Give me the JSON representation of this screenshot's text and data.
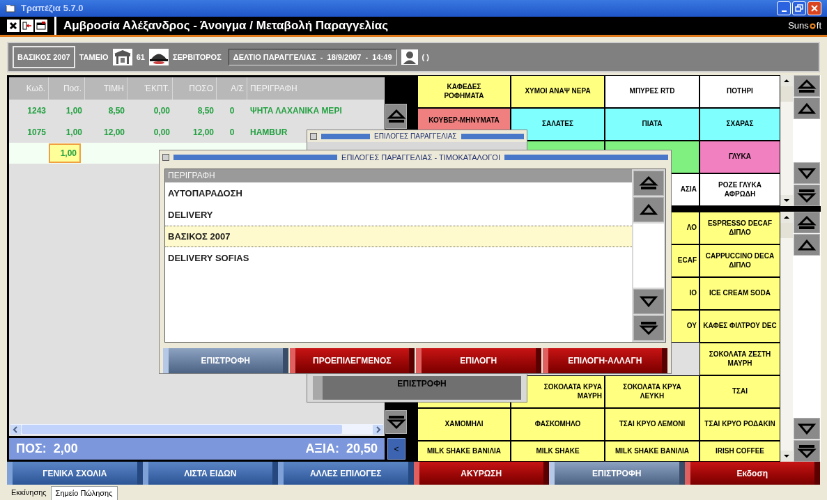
{
  "window": {
    "title": "Τραπέζια 5.7.0"
  },
  "header": {
    "title": "Αμβροσία Αλέξανδρος - Άνοιγμα / Μεταβολή Παραγγελίας",
    "logo_start": "Suns",
    "logo_end": "ft"
  },
  "info_bar": {
    "price_list": "ΒΑΣΙΚΟΣ 2007",
    "register_label": "ΤΑΜΕΙΟ",
    "table_number": "61",
    "waiter_label": "ΣΕΡΒΙΤΟΡΟΣ",
    "document": "ΔΕΛΤΙΟ ΠΑΡΑΓΓΕΛΙΑΣ  -  18/9/2007  -  14:49",
    "customer": "( )"
  },
  "order_table": {
    "columns": [
      "Κωδ.",
      "Ποσ.",
      "ΤΙΜΗ",
      "ΈΚΠΤ.",
      "ΠΟΣΟ",
      "Α/Σ",
      "ΠΕΡΙΓΡΑΦΗ"
    ],
    "rows": [
      {
        "cells": [
          "1243",
          "1,00",
          "8,50",
          "0,00",
          "8,50",
          "0",
          "ΨΗΤΑ ΛΑΧΑΝΙΚΑ ΜΕΡΙ"
        ]
      },
      {
        "cells": [
          "1075",
          "1,00",
          "12,00",
          "0,00",
          "12,00",
          "0",
          "HAMBUR"
        ]
      }
    ],
    "new_row": {
      "quantity": "1,00"
    }
  },
  "totals": {
    "count": "ΠΟΣ:  2,00",
    "value": "ΑΞΙΑ:  20,50",
    "nav_button": "<"
  },
  "category_grid": {
    "cells": [
      {
        "kind": "full",
        "label": "ΚΑΦΕΔΕΣ\nΡΟΦΗΜΑΤΑ",
        "color": "#ffff80"
      },
      {
        "kind": "full",
        "label": "ΧΥΜΟΙ ΑΝΑΨ ΝΕΡΑ",
        "color": "#ffff80"
      },
      {
        "kind": "full",
        "label": "ΜΠΥΡΕΣ RTD",
        "color": "#ffffff"
      },
      {
        "kind": "full",
        "label": "ΠΟΤΗΡΙ",
        "color": "#ffffff"
      },
      {
        "kind": "top",
        "label": "ΚΟΥΒΕΡ-ΜΗΝΥΜΑΤΑ",
        "color": "#f08080"
      },
      {
        "kind": "full",
        "label": "ΣΑΛΑΤΕΣ",
        "color": "#80ffff"
      },
      {
        "kind": "full",
        "label": "ΠΙΑΤΑ",
        "color": "#80ffff"
      },
      {
        "kind": "full",
        "label": "ΣΧΑΡΑΣ",
        "color": "#80ffff"
      },
      {
        "kind": "covered"
      },
      {
        "kind": "empty",
        "color": "#80f080"
      },
      {
        "kind": "empty",
        "color": "#80f080"
      },
      {
        "kind": "full",
        "label": "ΓΛΥΚΑ",
        "color": "#f080c0"
      },
      {
        "kind": "covered"
      },
      {
        "kind": "covered"
      },
      {
        "kind": "right",
        "label": "ΑΣΙΑ",
        "color": "#ffffff"
      },
      {
        "kind": "full",
        "label": "ΡΟΖΕ ΓΛΥΚΑ\nΑΦΡΩΔΗ",
        "color": "#ffffff"
      }
    ]
  },
  "product_grid": {
    "cells": [
      {
        "kind": "covered"
      },
      {
        "kind": "covered"
      },
      {
        "kind": "right",
        "label": "ΛΟ",
        "color": "#ffff80"
      },
      {
        "kind": "full",
        "label": "ESPRESSO DECAF\nΔΙΠΛΟ",
        "color": "#ffff80"
      },
      {
        "kind": "covered"
      },
      {
        "kind": "covered"
      },
      {
        "kind": "right",
        "label": "ECAF",
        "color": "#ffff80"
      },
      {
        "kind": "full",
        "label": "CAPPUCCINO DECA\nΔΙΠΛΟ",
        "color": "#ffff80"
      },
      {
        "kind": "covered"
      },
      {
        "kind": "covered"
      },
      {
        "kind": "right",
        "label": "ΙΟ",
        "color": "#ffff80"
      },
      {
        "kind": "full",
        "label": "ICE CREAM SODA",
        "color": "#ffff80"
      },
      {
        "kind": "covered"
      },
      {
        "kind": "covered"
      },
      {
        "kind": "right",
        "label": "ΟΥ",
        "color": "#ffff80"
      },
      {
        "kind": "full",
        "label": "ΚΑΦΕΣ ΦΙΛΤΡΟΥ DEC",
        "color": "#ffff80"
      },
      {
        "kind": "covered"
      },
      {
        "kind": "covered"
      },
      {
        "kind": "covered"
      },
      {
        "kind": "full",
        "label": "ΣΟΚΟΛΑΤΑ ΖΕΣΤΗ\nΜΑΥΡΗ",
        "color": "#ffff80"
      },
      {
        "kind": "empty",
        "color": "#ffff80"
      },
      {
        "kind": "right",
        "label": "ΣΟΚΟΛΑΤΑ ΚΡΥΑ\nΜΑΥΡΗ",
        "color": "#ffff80"
      },
      {
        "kind": "full",
        "label": "ΣΟΚΟΛΑΤΑ ΚΡΥΑ\nΛΕΥΚΗ",
        "color": "#ffff80"
      },
      {
        "kind": "full",
        "label": "ΤΣΑΙ",
        "color": "#ffff80"
      },
      {
        "kind": "full",
        "label": "ΧΑΜΟΜΗΛΙ",
        "color": "#ffff80"
      },
      {
        "kind": "full",
        "label": "ΦΑΣΚΟΜΗΛΟ",
        "color": "#ffff80"
      },
      {
        "kind": "full",
        "label": "ΤΣΑΙ ΚΡΥΟ ΛΕΜΟΝΙ",
        "color": "#ffff80"
      },
      {
        "kind": "full",
        "label": "ΤΣΑΙ ΚΡΥΟ ΡΟΔΑΚΙΝ",
        "color": "#ffff80"
      },
      {
        "kind": "full",
        "label": "MILK SHAKE ΒΑΝΙΛΙΑ",
        "color": "#ffff80"
      },
      {
        "kind": "full",
        "label": "MILK SHAKE",
        "color": "#ffff80"
      },
      {
        "kind": "full",
        "label": "MILK SHAKE ΒΑΝΙΛΙΑ",
        "color": "#ffff80"
      },
      {
        "kind": "full",
        "label": "IRISH COFFEE",
        "color": "#ffff80"
      }
    ]
  },
  "dialog_back": {
    "title": "ΕΠΙΛΟΓΕΣ ΠΑΡΑΓΓΕΛΙΑΣ",
    "button": "ΕΠΙΣΤΡΟΦΗ"
  },
  "dialog": {
    "title": "ΕΠΙΛΟΓΕΣ ΠΑΡΑΓΓΕΛΙΑΣ - ΤΙΜΟΚΑΤΑΛΟΓΟΙ",
    "column": "ΠΕΡΙΓΡΑΦΗ",
    "items": [
      {
        "label": "ΑΥΤΟΠΑΡΑΔΟΣΗ",
        "selected": false
      },
      {
        "label": "DELIVERY",
        "selected": false
      },
      {
        "label": "ΒΑΣΙΚΟΣ 2007",
        "selected": true
      },
      {
        "label": "DELIVERY SOFIAS",
        "selected": false
      }
    ],
    "buttons": [
      {
        "label": "ΕΠΙΣΤΡΟΦΗ",
        "kind": "slate"
      },
      {
        "label": "ΠΡΟΕΠΙΛΕΓΜΕΝΟΣ",
        "kind": "red"
      },
      {
        "label": "ΕΠΙΛΟΓΗ",
        "kind": "red"
      },
      {
        "label": "ΕΠΙΛΟΓΗ-ΑΛΛΑΓΗ",
        "kind": "red"
      }
    ]
  },
  "bottom_buttons": [
    {
      "label": "ΓΕΝΙΚΑ ΣΧΟΛΙΑ",
      "kind": "blue"
    },
    {
      "label": "ΛΙΣΤΑ ΕΙΔΩΝ",
      "kind": "blue"
    },
    {
      "label": "ΑΛΛΕΣ ΕΠΙΛΟΓΕΣ",
      "kind": "blue"
    },
    {
      "label": "ΑΚΥΡΩΣΗ",
      "kind": "red"
    },
    {
      "label": "ΕΠΙΣΤΡΟΦΗ",
      "kind": "slate"
    },
    {
      "label": "Εκδοση",
      "kind": "red"
    }
  ],
  "tabs": [
    {
      "label": "Εκκίνησης",
      "selected": false
    },
    {
      "label": "Σημείο Πώλησης",
      "selected": true
    }
  ]
}
